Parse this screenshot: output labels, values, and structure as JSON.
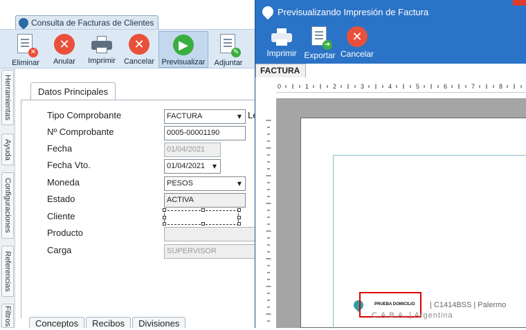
{
  "back_window": {
    "tab_title": "Consulta de Facturas de Clientes",
    "toolbar": [
      {
        "label": "Eliminar",
        "icon": "delete-doc-icon"
      },
      {
        "label": "Anular",
        "icon": "cancel-x-icon"
      },
      {
        "label": "Imprimir",
        "icon": "printer-icon"
      },
      {
        "label": "Cancelar",
        "icon": "cancel-x-icon"
      },
      {
        "label": "Previsualizar",
        "icon": "play-icon"
      },
      {
        "label": "Adjuntar",
        "icon": "attach-doc-icon"
      }
    ],
    "side_tabs": [
      "Herramientas",
      "Ayuda",
      "Configuraciones",
      "Referencias",
      "Filtros"
    ],
    "section_tab": "Datos Principales",
    "fields": {
      "tipo_label": "Tipo Comprobante",
      "tipo_value": "FACTURA",
      "tipo_trailing": "Le",
      "numero_label": "Nº Comprobante",
      "numero_value": "0005-00001190",
      "fecha_label": "Fecha",
      "fecha_value": "01/04/2021",
      "fecha_vto_label": "Fecha Vto.",
      "fecha_vto_value": "01/04/2021",
      "moneda_label": "Moneda",
      "moneda_value": "PESOS",
      "estado_label": "Estado",
      "estado_value": "ACTIVA",
      "cliente_label": "Cliente",
      "cliente_value": "",
      "producto_label": "Producto",
      "producto_value": "",
      "carga_label": "Carga",
      "carga_value": "SUPERVISOR"
    },
    "bottom_tabs": [
      "Conceptos",
      "Recibos",
      "Divisiones"
    ]
  },
  "preview_window": {
    "title": "Previsualizando Impresión de Factura",
    "toolbar": [
      {
        "label": "Imprimir",
        "icon": "printer-icon"
      },
      {
        "label": "Exportar",
        "icon": "export-doc-icon"
      },
      {
        "label": "Cancelar",
        "icon": "cancel-x-icon"
      }
    ],
    "report_tab": "FACTURA",
    "ruler_labels": [
      "0",
      "1",
      "2",
      "3",
      "4",
      "5",
      "6",
      "7",
      "8"
    ],
    "address": {
      "name": "PRUEBA DOMICILIO",
      "line1": "| C1414BSS | Palermo",
      "line2": "C.A.B.A. | Argentina"
    }
  },
  "colors": {
    "accent_blue": "#2b73c6",
    "toolbar_bg": "#dce8f4",
    "danger_red": "#e9503a",
    "success_green": "#3aae3f",
    "highlight_red": "#e00000"
  }
}
